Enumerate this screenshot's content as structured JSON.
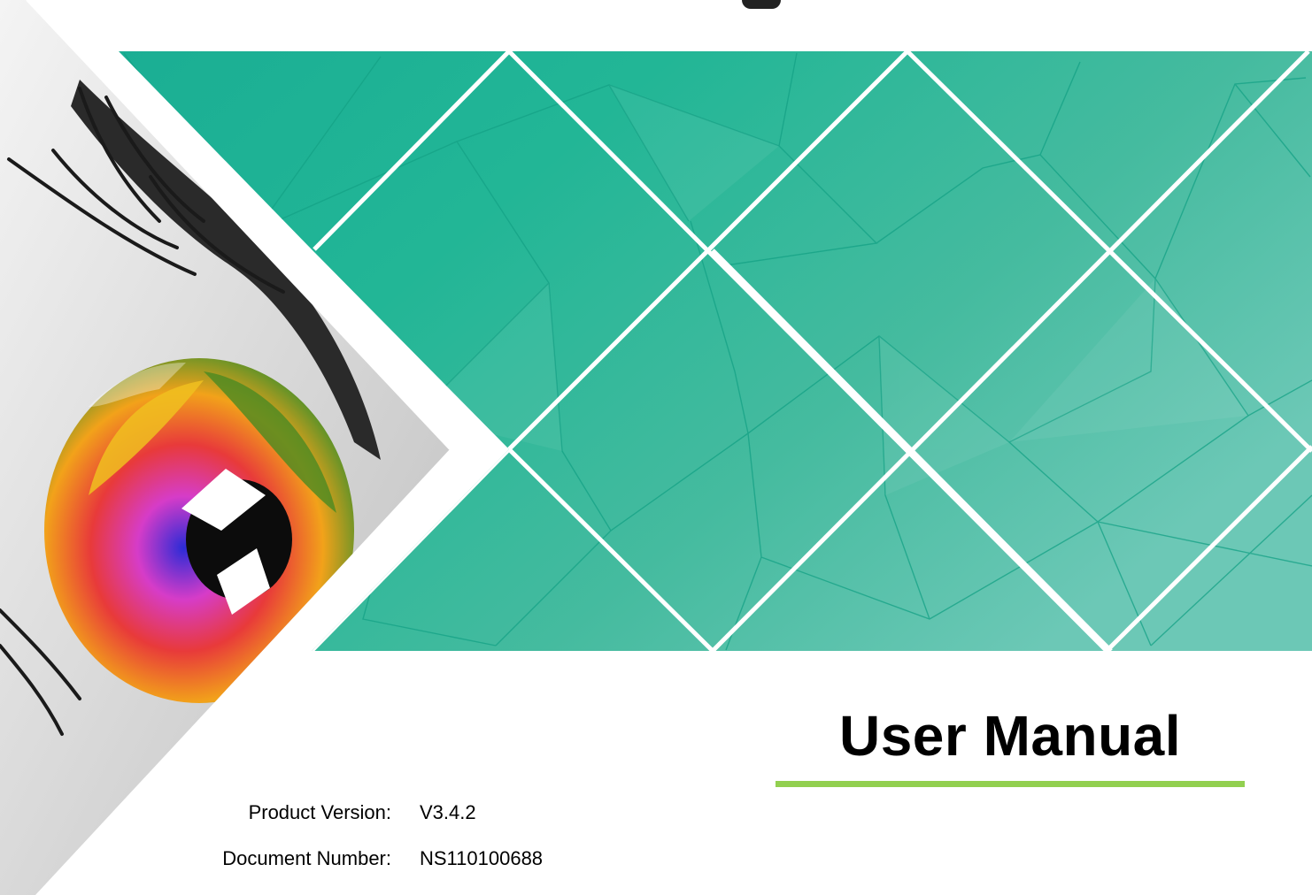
{
  "document": {
    "title": "User Manual",
    "accent_color": "#92d050",
    "banner_color": "#1fb393"
  },
  "metadata": [
    {
      "label": "Product Version:",
      "value": "V3.4.2"
    },
    {
      "label": "Document Number:",
      "value": "NS110100688"
    }
  ],
  "decorations": {
    "top_mark": "logo-fragment",
    "left_image": "colorful-eye-photo",
    "banner": "green-triangulated-diamond-banner"
  }
}
